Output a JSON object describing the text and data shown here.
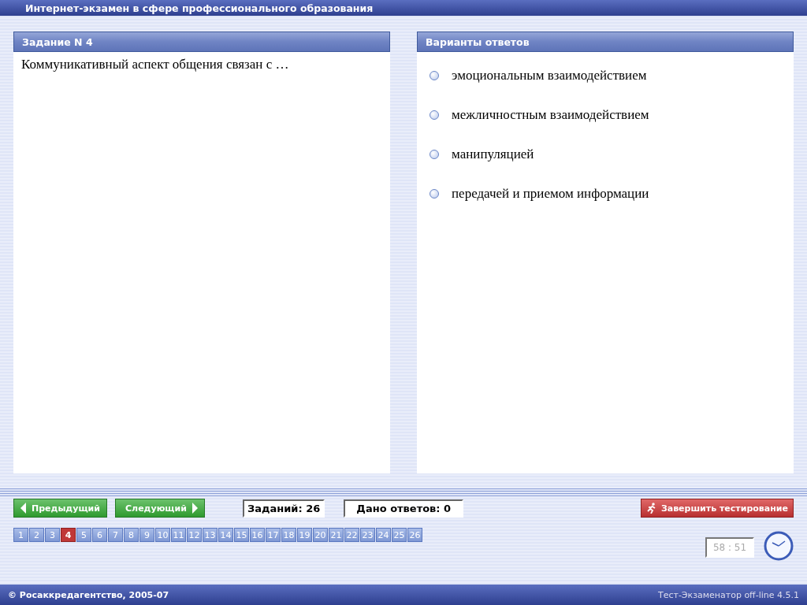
{
  "window": {
    "title": "Интернет-экзамен в сфере профессионального образования"
  },
  "task_panel": {
    "title": "Задание N 4",
    "question": "Коммуникативный аспект общения связан с …"
  },
  "answers_panel": {
    "title": "Варианты ответов",
    "options": [
      {
        "label": "эмоциональным взаимодействием",
        "selected": false
      },
      {
        "label": "межличностным взаимодействием",
        "selected": false
      },
      {
        "label": "манипуляцией",
        "selected": false
      },
      {
        "label": "передачей и приемом информации",
        "selected": false
      }
    ]
  },
  "nav": {
    "prev": "Предыдущий",
    "next": "Следующий",
    "tasks_count": "Заданий: 26",
    "answers_count": "Дано ответов: 0",
    "finish": "Завершить тестирование"
  },
  "pages": [
    {
      "label": "1",
      "selected": false
    },
    {
      "label": "2",
      "selected": false
    },
    {
      "label": "3",
      "selected": false
    },
    {
      "label": "4",
      "selected": true
    },
    {
      "label": "5",
      "selected": false
    },
    {
      "label": "6",
      "selected": false
    },
    {
      "label": "7",
      "selected": false
    },
    {
      "label": "8",
      "selected": false
    },
    {
      "label": "9",
      "selected": false
    },
    {
      "label": "10",
      "selected": false
    },
    {
      "label": "11",
      "selected": false
    },
    {
      "label": "12",
      "selected": false
    },
    {
      "label": "13",
      "selected": false
    },
    {
      "label": "14",
      "selected": false
    },
    {
      "label": "15",
      "selected": false
    },
    {
      "label": "16",
      "selected": false
    },
    {
      "label": "17",
      "selected": false
    },
    {
      "label": "18",
      "selected": false
    },
    {
      "label": "19",
      "selected": false
    },
    {
      "label": "20",
      "selected": false
    },
    {
      "label": "21",
      "selected": false
    },
    {
      "label": "22",
      "selected": false
    },
    {
      "label": "23",
      "selected": false
    },
    {
      "label": "24",
      "selected": false
    },
    {
      "label": "25",
      "selected": false
    },
    {
      "label": "26",
      "selected": false
    }
  ],
  "timer": "58 : 51",
  "status_bar": {
    "copyright": "© Росаккредагентство, 2005-07",
    "version": "Тест-Экзаменатор off-line 4.5.1"
  }
}
